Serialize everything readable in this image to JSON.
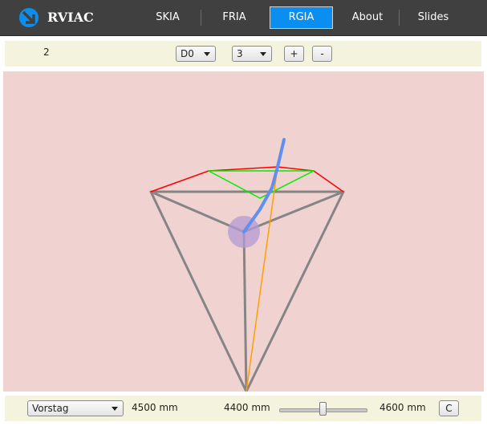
{
  "header": {
    "app_title": "RVIAC",
    "tabs": [
      {
        "label": "SKIA",
        "active": false
      },
      {
        "label": "FRIA",
        "active": false
      },
      {
        "label": "RGIA",
        "active": true
      },
      {
        "label": "About",
        "active": false
      },
      {
        "label": "Slides",
        "active": false
      }
    ],
    "accent_color": "#0a8ff0"
  },
  "toolbar": {
    "counter": "2",
    "preset_select": "D0",
    "count_select": "3",
    "plus_label": "+",
    "minus_label": "-"
  },
  "viewport": {
    "background_color": "#f0d2d0",
    "colors": {
      "frame": "#858585",
      "top_outline": "#ff0000",
      "inner_triangle": "#00ee00",
      "orange_line": "#ffa000",
      "blue_rod": "#5f8ff0",
      "joint_circle": "#b59ad6"
    }
  },
  "bottom": {
    "parameter_select": "Vorstag",
    "min_label": "4500 mm",
    "current_label": "4400 mm",
    "max_label": "4600 mm",
    "slider_fraction": 0.5,
    "reset_label": "C"
  }
}
